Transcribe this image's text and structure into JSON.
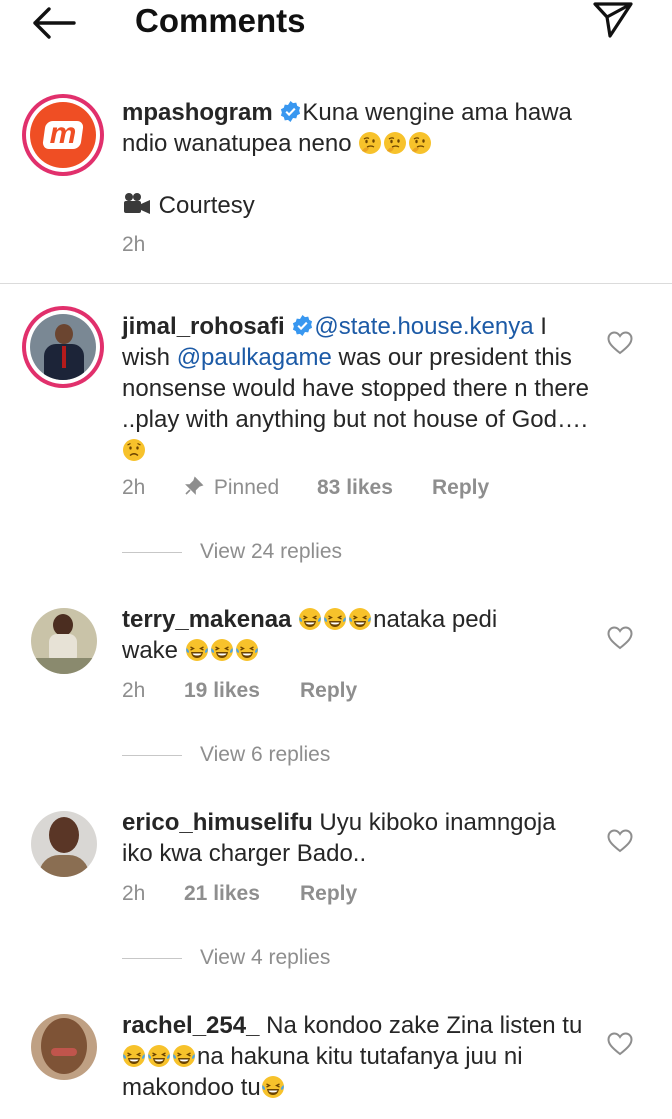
{
  "header": {
    "title": "Comments"
  },
  "caption": {
    "username": "mpashogram",
    "text": "Kuna wengine ama hawa ndio wanatupea neno",
    "courtesy": "Courtesy",
    "time": "2h",
    "avatar_letter": "m"
  },
  "comments": [
    {
      "username": "jimal_rohosafi",
      "mention1": "@state.house.kenya",
      "text_a": " I wish ",
      "mention2": "@paulkagame",
      "text_b": " was our president this nonsense would have stopped there n there ..play with anything but not house of God….",
      "time": "2h",
      "pinned": "Pinned",
      "likes": "83 likes",
      "reply": "Reply",
      "view_replies": "View 24 replies"
    },
    {
      "username": "terry_makenaa",
      "text_a": "nataka pedi",
      "text_b": "wake",
      "time": "2h",
      "likes": "19 likes",
      "reply": "Reply",
      "view_replies": "View 6 replies"
    },
    {
      "username": "erico_himuselifu",
      "text": "Uyu kiboko inamngoja iko kwa charger Bado..",
      "time": "2h",
      "likes": "21 likes",
      "reply": "Reply",
      "view_replies": "View 4 replies"
    },
    {
      "username": "rachel_254_",
      "text_a": " Na kondoo zake Zina listen tu",
      "text_b": "na hakuna kitu tutafanya juu ni makondoo tu"
    }
  ],
  "icons": {
    "back": "back-arrow-icon",
    "send": "send-icon",
    "verified": "verified-badge-icon",
    "heart": "heart-icon",
    "pin": "pin-icon",
    "camera": "video-camera-icon"
  },
  "colors": {
    "brand_ring": "#e1306c",
    "mention": "#1c5aa6",
    "verified": "#3897f0",
    "muted": "#8e8e8e"
  }
}
